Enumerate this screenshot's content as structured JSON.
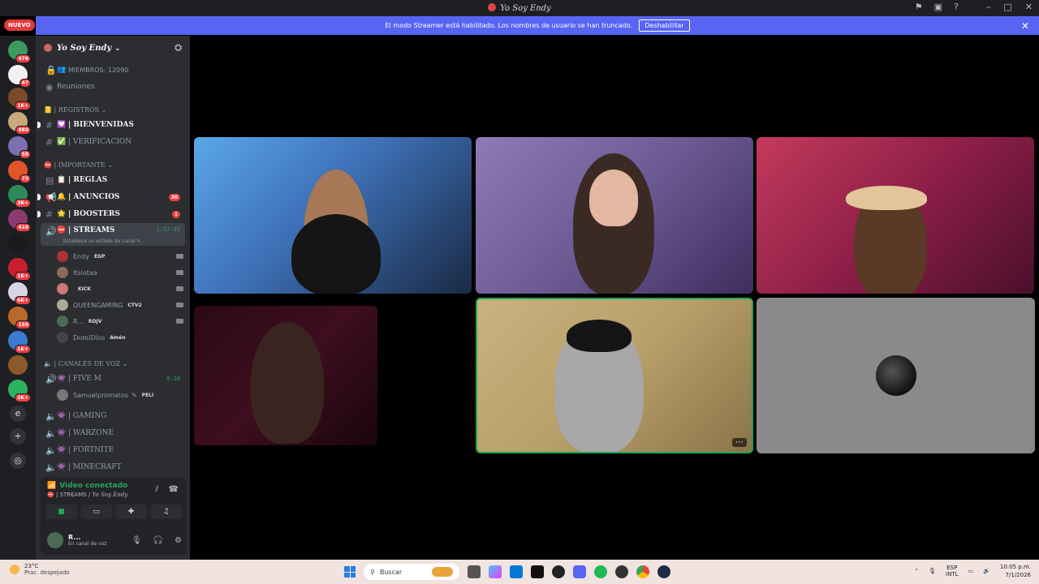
{
  "window": {
    "title": "Yo Soy Endy"
  },
  "banner": {
    "text": "El modo Streamer está habilitado. Los nombres de usuario se han truncado.",
    "button": "Deshabilitar"
  },
  "new_badge": "NUEVO",
  "guilds": [
    {
      "badge": "476",
      "color": "#3c9a5f"
    },
    {
      "badge": "47",
      "color": "#f2f2f2"
    },
    {
      "badge": "1K+",
      "color": "#7a4a2b"
    },
    {
      "badge": "980",
      "color": "#c9a87c"
    },
    {
      "badge": "58",
      "color": "#7c6fb0"
    },
    {
      "badge": "73",
      "color": "#e0562a"
    },
    {
      "badge": "3K+",
      "color": "#2e8b57"
    },
    {
      "badge": "410",
      "color": "#8a3a6d"
    },
    {
      "badge": "",
      "color": "#1b1b1b"
    },
    {
      "badge": "1K+",
      "color": "#c8202e"
    },
    {
      "badge": "6K+",
      "color": "#d5d5e5"
    },
    {
      "badge": "159",
      "color": "#b86a2c"
    },
    {
      "badge": "1K+",
      "color": "#3b7bd1"
    },
    {
      "badge": "",
      "color": "#8a5a2a"
    },
    {
      "badge": "2K+",
      "color": "#2bb35f"
    }
  ],
  "guild_extra": {
    "letter": "e"
  },
  "server": {
    "name": "Yo Soy Endy"
  },
  "channels": {
    "members": "MIEMBROS: 12090",
    "meetings": "Reuniones",
    "cat_registros": "| REGISTROS",
    "bienvenidas": "| BIENVENIDAS",
    "verificacion": "| VERIFICACION",
    "cat_importante": "| IMPORTANTE",
    "reglas": "| REGLAS",
    "anuncios": "| ANUNCIOS",
    "anuncios_badge": "30",
    "boosters": "| BOOSTERS",
    "boosters_badge": "1",
    "streams": "| STREAMS",
    "streams_timer": "1:57:33",
    "streams_status": "Establece un estado de canal",
    "cat_voz": "| CANALES DE VOZ",
    "fivem": "| FIVE M",
    "fivem_timer": "0:10",
    "gaming": "| GAMING",
    "warzone": "| WARZONE",
    "fortnite": "| FORTNITE",
    "minecraft": "| MINECRAFT"
  },
  "stream_users": [
    {
      "name": "Endy",
      "tag": "EGP",
      "color": "#a33"
    },
    {
      "name": "Itslotaa",
      "tag": "",
      "color": "#8a6a5a"
    },
    {
      "name": "",
      "tag": "KICK",
      "color": "#c77"
    },
    {
      "name": "QUEENGAMING",
      "tag": "CTV2",
      "color": "#aa9"
    },
    {
      "name": "R...",
      "tag": "RDJV",
      "color": "#4a6b52"
    },
    {
      "name": "DomiDios",
      "tag": "Amén",
      "color": "#444"
    }
  ],
  "fivem_user": {
    "name": "Samuelpromatos",
    "tag": "PELI",
    "color": "#777"
  },
  "voice_panel": {
    "status": "Video conectado",
    "channel": "| STREAMS /",
    "server": "Yo Soy Endy",
    "user": "R...",
    "user_status": "En canal de voz"
  },
  "taskbar": {
    "temp": "23°C",
    "weather": "Prac. despejado",
    "search": "Buscar",
    "lang1": "ESP",
    "lang2": "INTL",
    "time": "10:05 p.m.",
    "date": "7/1/2026"
  }
}
